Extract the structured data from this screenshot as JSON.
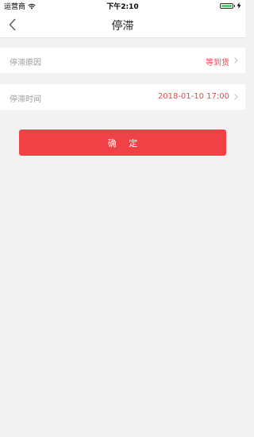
{
  "status_bar": {
    "carrier": "运营商",
    "time": "下午2:10",
    "battery_level": 1.0,
    "battery_color": "#4cd964"
  },
  "nav": {
    "title": "停滞",
    "back_icon": "chevron-left-icon"
  },
  "form": {
    "reason": {
      "label": "停滞原因",
      "value": "等到货"
    },
    "time": {
      "label": "停滞时间",
      "value": "2018-01-10 17:00"
    }
  },
  "actions": {
    "confirm_label": "确 定"
  },
  "colors": {
    "accent": "#ef4146",
    "value_text": "#e84a4f",
    "background": "#f2f2f2"
  }
}
